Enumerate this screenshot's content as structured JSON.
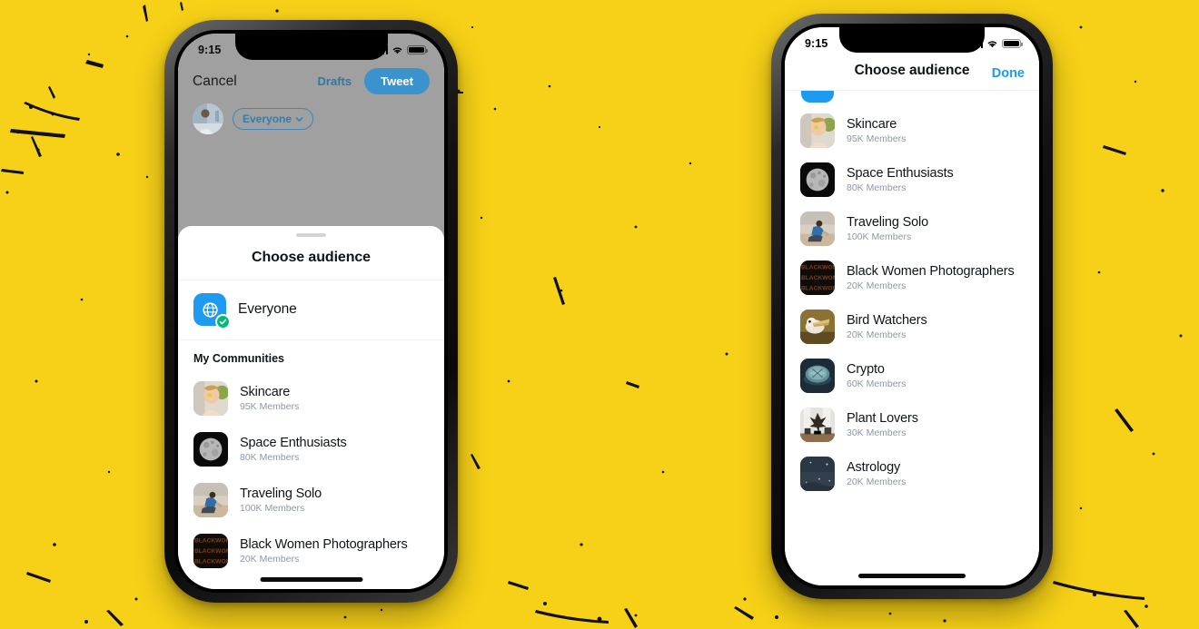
{
  "background": {
    "color": "#F7D117",
    "texture": "black-speckle-grunge"
  },
  "theme": {
    "twitter_blue": "#1D9BF0",
    "verified_green": "#00BA7C",
    "text_primary": "#0F1419",
    "text_secondary": "#8B98A5"
  },
  "phone_left": {
    "status_bar": {
      "time": "9:15",
      "signal_icon": "cellular-bars-icon",
      "wifi_icon": "wifi-icon",
      "battery_icon": "battery-full-icon"
    },
    "composer": {
      "cancel_label": "Cancel",
      "drafts_label": "Drafts",
      "tweet_label": "Tweet",
      "avatar_name": "user-avatar",
      "audience_pill_label": "Everyone",
      "chevron_icon": "chevron-down-icon"
    },
    "sheet": {
      "grabber": "sheet-grabber",
      "title": "Choose audience",
      "everyone": {
        "label": "Everyone",
        "icon": "globe-icon",
        "selected": true,
        "check_icon": "check-icon"
      },
      "section_label": "My Communities",
      "communities": [
        {
          "name": "Skincare",
          "members": "95K Members",
          "thumb": "skincare-thumb"
        },
        {
          "name": "Space Enthusiasts",
          "members": "80K Members",
          "thumb": "moon-thumb"
        },
        {
          "name": "Traveling Solo",
          "members": "100K Members",
          "thumb": "traveler-thumb"
        },
        {
          "name": "Black Women Photographers",
          "members": "20K Members",
          "thumb": "bwp-thumb"
        }
      ]
    },
    "home_indicator": "home-indicator"
  },
  "phone_right": {
    "status_bar": {
      "time": "9:15",
      "signal_icon": "cellular-bars-icon",
      "wifi_icon": "wifi-icon",
      "battery_icon": "battery-full-icon"
    },
    "nav": {
      "title": "Choose audience",
      "done_label": "Done"
    },
    "communities": [
      {
        "name": "Skincare",
        "members": "95K Members",
        "thumb": "skincare-thumb"
      },
      {
        "name": "Space Enthusiasts",
        "members": "80K Members",
        "thumb": "moon-thumb"
      },
      {
        "name": "Traveling Solo",
        "members": "100K Members",
        "thumb": "traveler-thumb"
      },
      {
        "name": "Black Women Photographers",
        "members": "20K Members",
        "thumb": "bwp-thumb"
      },
      {
        "name": "Bird Watchers",
        "members": "20K Members",
        "thumb": "bird-thumb"
      },
      {
        "name": "Crypto",
        "members": "60K Members",
        "thumb": "crypto-thumb"
      },
      {
        "name": "Plant Lovers",
        "members": "30K Members",
        "thumb": "plants-thumb"
      },
      {
        "name": "Astrology",
        "members": "20K Members",
        "thumb": "astrology-thumb"
      }
    ],
    "home_indicator": "home-indicator"
  }
}
